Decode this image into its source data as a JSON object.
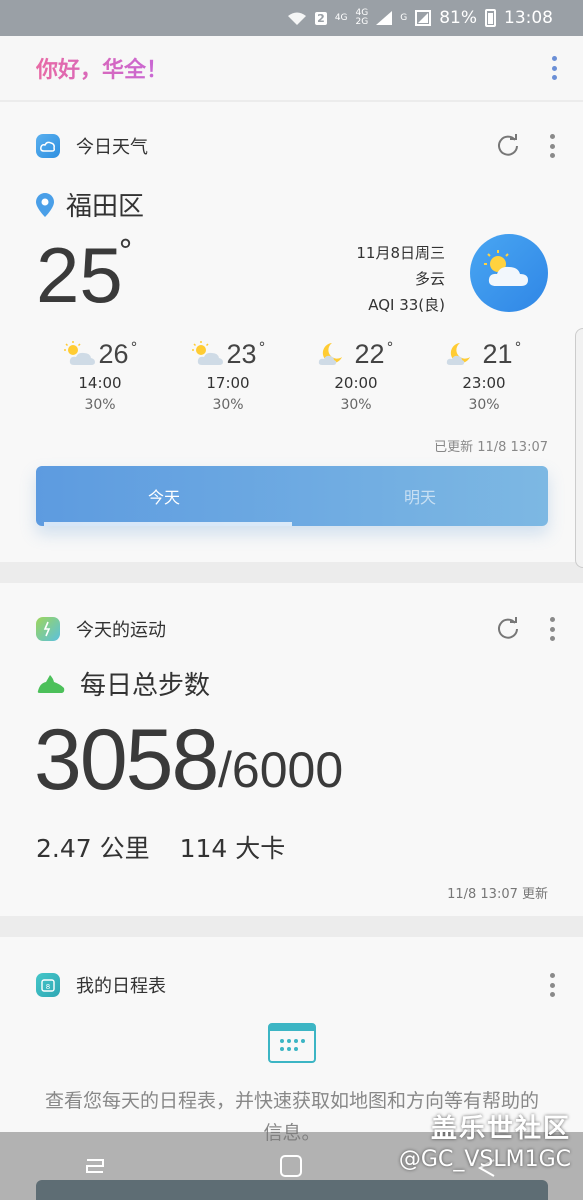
{
  "status_bar": {
    "sim_badge": "2",
    "net_a": "4G",
    "net_b": "4G",
    "net_c": "2G",
    "net_d": "G",
    "battery": "81%",
    "time": "13:08"
  },
  "greeting": "你好，华全！",
  "weather_card": {
    "title": "今日天气",
    "location": "福田区",
    "temperature": "25",
    "degree": "°",
    "date": "11月8日周三",
    "condition": "多云",
    "aqi": "AQI 33(良)",
    "hourly": [
      {
        "temp": "26",
        "time": "14:00",
        "precip": "30%",
        "icon": "partly-sunny-icon"
      },
      {
        "temp": "23",
        "time": "17:00",
        "precip": "30%",
        "icon": "partly-sunny-icon"
      },
      {
        "temp": "22",
        "time": "20:00",
        "precip": "30%",
        "icon": "moon-cloud-icon"
      },
      {
        "temp": "21",
        "time": "23:00",
        "precip": "30%",
        "icon": "moon-cloud-icon"
      }
    ],
    "updated": "已更新 11/8 13:07",
    "tabs": [
      "今天",
      "明天"
    ]
  },
  "steps_card": {
    "title": "今天的运动",
    "subtitle": "每日总步数",
    "steps": "3058",
    "goal": "/6000",
    "distance": "2.47 公里",
    "calories": "114 大卡",
    "updated": "11/8 13:07 更新"
  },
  "schedule_card": {
    "title": "我的日程表",
    "description": "查看您每天的日程表，并快速获取如地图和方向等有帮助的信息。"
  },
  "watermark": {
    "line1": "盖乐世社区",
    "line2": "@GC_VSLM1GC"
  },
  "colors": {
    "accent_blue": "#5d9be0",
    "greeting_pink": "#e86aa5",
    "teal": "#3cb5c4"
  }
}
